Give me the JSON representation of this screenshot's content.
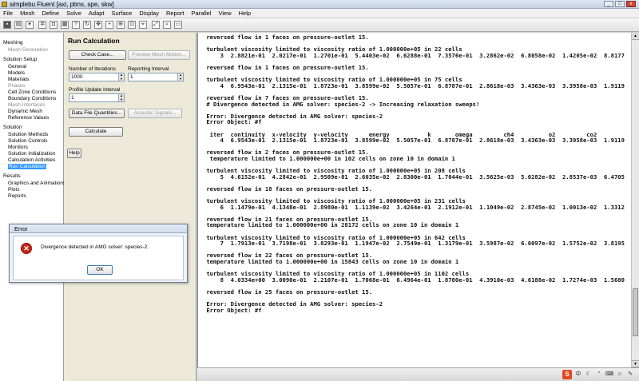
{
  "window": {
    "title": "simplebu Fluent  [axi, pbns, spe, skw]",
    "buttons": [
      "_",
      "□",
      "x"
    ]
  },
  "menu": [
    "File",
    "Mesh",
    "Define",
    "Solve",
    "Adapt",
    "Surface",
    "Display",
    "Report",
    "Parallel",
    "View",
    "Help"
  ],
  "tree": {
    "mesh_header": "Meshing",
    "mesh_generation": "Mesh Generation",
    "setup_header": "Solution Setup",
    "setup_items": [
      "General",
      "Models",
      "Materials",
      "Phases",
      "Cell Zone Conditions",
      "Boundary Conditions",
      "Mesh Interfaces",
      "Dynamic Mesh",
      "Reference Values"
    ],
    "solution_header": "Solution",
    "solution_items": [
      "Solution Methods",
      "Solution Controls",
      "Monitors",
      "Solution Initialization",
      "Calculation Activities",
      "Run Calculation"
    ],
    "results_header": "Results",
    "results_items": [
      "Graphics and Animations",
      "Plots",
      "Reports"
    ]
  },
  "panel": {
    "title": "Run Calculation",
    "check_case": "Check Case...",
    "preview_mesh_motion": "Preview Mesh Motion...",
    "iterations_label": "Number of Iterations",
    "iterations_value": "1000",
    "reporting_label": "Reporting Interval",
    "reporting_value": "1",
    "profile_label": "Profile Update Interval",
    "profile_value": "1",
    "data_file_quantities": "Data File Quantities...",
    "acoustic_signals": "Acoustic Signals...",
    "calculate": "Calculate",
    "help": "Help"
  },
  "console_text": " reversed flow in 1 faces on pressure-outlet 15.\n\n turbulent viscosity limited to viscosity ratio of 1.000000e+05 in 22 cells\n     3  2.8821e-01  2.0217e-01  1.2701e-01  5.4403e-02  6.6288e-01  7.3576e-01  3.2862e-02  6.8058e-02  1.4205e-02  8.8177\n\n reversed flow in 1 faces on pressure-outlet 15.\n\n turbulent viscosity limited to viscosity ratio of 1.000000e+05 in 75 cells\n     4  6.9543e-01  2.1315e-01  1.8723e-01  3.8599e-02  5.5057e-01  6.8787e-01  2.8618e-03  3.4363e-03  3.3958e-03  1.9119\n\n reversed flow in 7 faces on pressure-outlet 15.\n # Divergence detected in AMG solver: species-2 -> Increasing relaxation sweeps!\n\n Error: Divergence detected in AMG solver: species-2\n Error Object: #f\n\n  iter  continuity  x-velocity  y-velocity      energy           k       omega         ch4          o2         co2\n     4  6.9543e-01  2.1315e-01  1.8723e-01  3.8599e-02  5.5057e-01  6.8787e-01  2.8618e-03  3.4363e-03  3.3958e-03  1.9119\n\n reversed flow in 2 faces on pressure-outlet 15.\n  temperature limited to 1.000000e+00 in 102 cells on zone 10 in domain 1\n\n turbulent viscosity limited to viscosity ratio of 1.000000e+05 in 208 cells\n     5  4.6152e-01  4.2842e-01  2.9509e-01  2.6035e-02  2.8300e-01  1.7044e-01  3.5625e-03  5.0282e-02  2.8537e-03  6.4705\n\n reversed flow in 18 faces on pressure-outlet 15.\n\n turbulent viscosity limited to viscosity ratio of 1.000000e+05 in 231 cells\n     6  1.1479e-01  4.1348e-01  2.8980e-01  1.1139e-02  3.4264e-01  2.1912e-01  1.1049e-02  2.8745e-02  1.0013e-02  1.3312\n\n reversed flow in 21 faces on pressure-outlet 15.\n temperature limited to 1.000000e+00 in 28172 cells on zone 10 in domain 1\n\n turbulent viscosity limited to viscosity ratio of 1.000000e+05 in 642 cells\n     7  1.7913e-01  3.7198e-01  3.8293e-01  1.1947e-02  2.7549e-01  1.3179e-01  3.5987e-02  6.0097e-02  1.5752e-02  3.8195\n\n reversed flow in 22 faces on pressure-outlet 15.\n temperature limited to 1.000000e+00 in 15843 cells on zone 10 in domain 1\n\n turbulent viscosity limited to viscosity ratio of 1.000000e+05 in 1102 cells\n     8  4.0334e+00  3.0090e-01  2.2107e-01  1.7068e-01  6.4964e-01  1.8780e-01  4.3910e-03  4.6188e-02  1.7274e-03  1.5680\n\n reversed flow in 25 faces on pressure-outlet 15.\n\n Error: Divergence detected in AMG solver: species-2\n Error Object: #f",
  "dialog": {
    "title": "Error",
    "message": "Divergence detected in AMG solver: species-2",
    "ok": "OK"
  },
  "tray": {
    "ime": "S",
    "lang": "中"
  },
  "colors": {
    "selection": "#3399ff",
    "error_icon": "#c82318"
  }
}
